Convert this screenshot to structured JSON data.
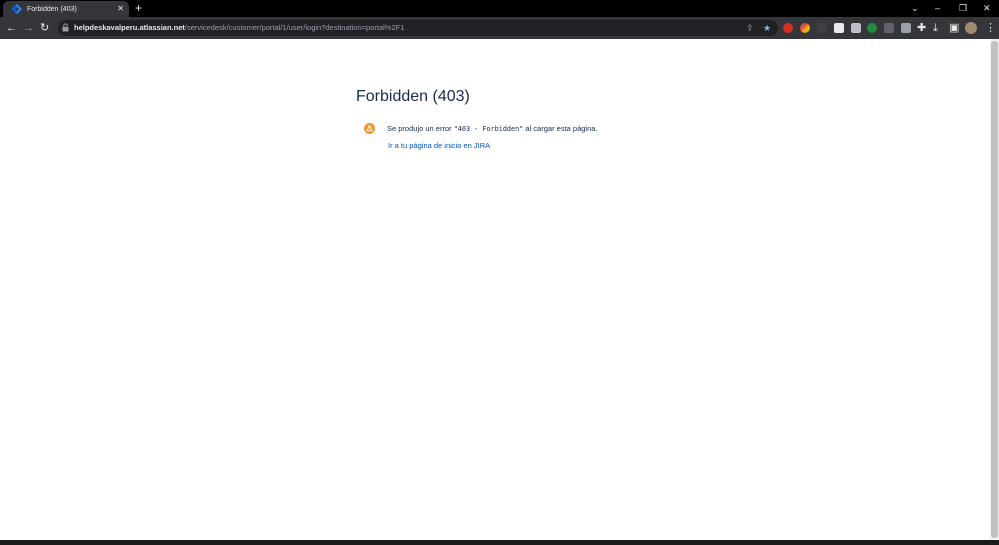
{
  "browser": {
    "tab_title": "Forbidden (403)",
    "url_host": "helpdeskavalperu.atlassian.net",
    "url_path": "/servicedesk/customer/portal/1/user/login?destination=portal%2F1"
  },
  "page": {
    "title": "Forbidden (403)",
    "message_prefix": "Se produjo un error",
    "message_code": "\"403 - Forbidden\"",
    "message_suffix": "al cargar esta página.",
    "link_text": "Ir a tu página de inicio en JIRA"
  },
  "colors": {
    "warning": "#f79232",
    "link": "#0052cc",
    "heading": "#172b4d"
  }
}
